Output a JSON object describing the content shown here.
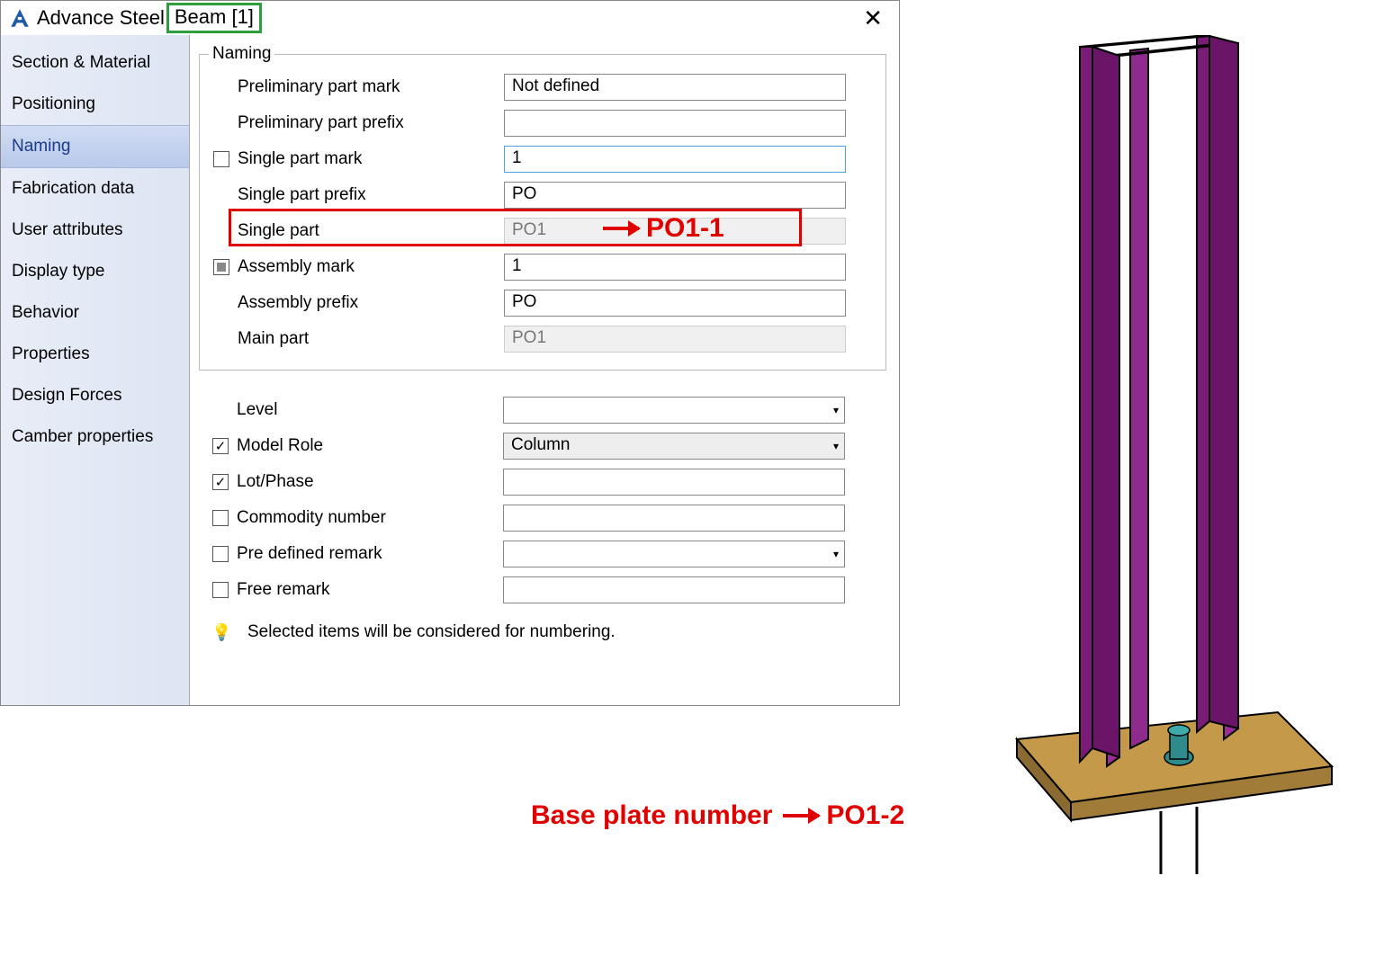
{
  "title": {
    "app": "Advance Steel",
    "object": "Beam [1]"
  },
  "sidebar": {
    "items": [
      {
        "label": "Section & Material"
      },
      {
        "label": "Positioning"
      },
      {
        "label": "Naming"
      },
      {
        "label": "Fabrication data"
      },
      {
        "label": "User attributes"
      },
      {
        "label": "Display type"
      },
      {
        "label": "Behavior"
      },
      {
        "label": "Properties"
      },
      {
        "label": "Design Forces"
      },
      {
        "label": "Camber properties"
      }
    ],
    "active_index": 2
  },
  "naming": {
    "legend": "Naming",
    "preliminary_part_mark": {
      "label": "Preliminary part mark",
      "value": "Not defined"
    },
    "preliminary_part_prefix": {
      "label": "Preliminary part prefix",
      "value": ""
    },
    "single_part_mark": {
      "label": "Single part mark",
      "value": "1"
    },
    "single_part_prefix": {
      "label": "Single part prefix",
      "value": "PO"
    },
    "single_part": {
      "label": "Single part",
      "value": "PO1"
    },
    "assembly_mark": {
      "label": "Assembly mark",
      "value": "1"
    },
    "assembly_prefix": {
      "label": "Assembly prefix",
      "value": "PO"
    },
    "main_part": {
      "label": "Main part",
      "value": "PO1"
    }
  },
  "numbering": {
    "level": {
      "label": "Level",
      "value": ""
    },
    "model_role": {
      "label": "Model Role",
      "value": "Column"
    },
    "lot_phase": {
      "label": "Lot/Phase",
      "value": ""
    },
    "commodity_number": {
      "label": "Commodity number",
      "value": ""
    },
    "pre_defined_remark": {
      "label": "Pre defined remark",
      "value": ""
    },
    "free_remark": {
      "label": "Free remark",
      "value": ""
    },
    "hint": "Selected items will be considered for numbering."
  },
  "annotations": {
    "single_part_target": "PO1-1",
    "base_plate_label": "Base plate number",
    "base_plate_value": "PO1-2"
  }
}
